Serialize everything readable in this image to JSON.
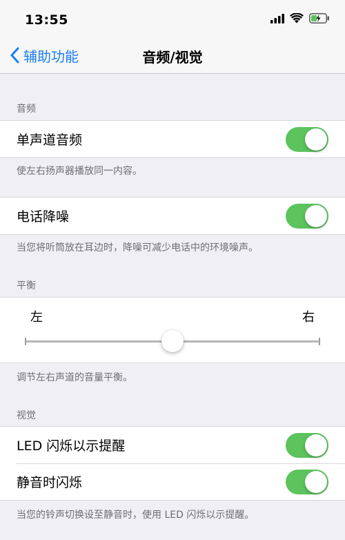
{
  "status_bar": {
    "time": "13:55"
  },
  "nav": {
    "back_label": "辅助功能",
    "title": "音频/视觉"
  },
  "audio": {
    "header": "音频",
    "mono_audio": {
      "label": "单声道音频",
      "on": true
    },
    "mono_footer": "使左右扬声器播放同一内容。",
    "phone_noise": {
      "label": "电话降噪",
      "on": true
    },
    "phone_noise_footer": "当您将听筒放在耳边时，降噪可减少电话中的环境噪声。"
  },
  "balance": {
    "header": "平衡",
    "left_label": "左",
    "right_label": "右",
    "value": 0.5,
    "footer": "调节左右声道的音量平衡。"
  },
  "visual": {
    "header": "视觉",
    "led_flash": {
      "label": "LED 闪烁以示提醒",
      "on": true
    },
    "silent_flash": {
      "label": "静音时闪烁",
      "on": true
    },
    "footer": "当您的铃声切换设至静音时，使用 LED 闪烁以示提醒。"
  },
  "colors": {
    "accent": "#1a7ef5",
    "toggle_on": "#5cc35d",
    "background": "#efeff4"
  }
}
